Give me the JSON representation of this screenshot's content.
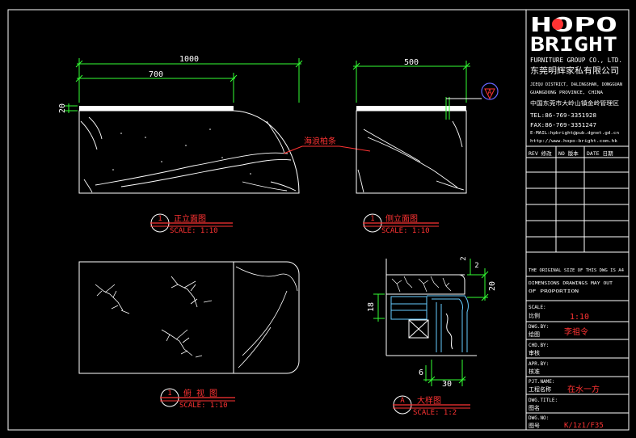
{
  "brand": {
    "logo_line1": "HOPO",
    "logo_line2": "BRIGHT",
    "company_en": "FURNITURE GROUP CO., LTD.",
    "company_cn": "东莞明辉家私有限公司",
    "address_en_1": "JIEQU DISTRICT, DALINGSHAN, DONGGUAN",
    "address_en_2": "GUANGDONG PROVINCE, CHINA",
    "address_cn": "中国东莞市大岭山镇金岭管理区",
    "tel": "TEL:86-769-3351928",
    "fax": "FAX:86-769-3351247",
    "email": "E-MAIL:hpbright@pub.dgnet.gd.cn",
    "web": "http://www.hopo-bright.com.hk"
  },
  "revision_headers": [
    "REV 修改",
    "NO 版本",
    "DATE 日期"
  ],
  "note_lines": [
    "THE ORIGINAL SIZE OF THIS DWG IS A4",
    "DIMENSIONS DRAWINGS MAY OUT",
    "OF PROPORTION"
  ],
  "title_block": {
    "scale_label_en": "SCALE:",
    "scale_label_cn": "比例",
    "scale_value": "1:10",
    "drawn_label_en": "DWG.BY:",
    "drawn_label_cn": "绘图",
    "drawn_value": "李祖令",
    "checked_label_en": "CHD.BY:",
    "checked_label_cn": "审核",
    "approved_label_en": "APR.BY:",
    "approved_label_cn": "核准",
    "project_label_en": "PJT.NAME:",
    "project_label_cn": "工程名称",
    "project_value": "在水一方",
    "title_label_en": "DWG.TITLE:",
    "title_label_cn": "图名",
    "number_label_en": "DWG.NO:",
    "number_label_cn": "图号",
    "number_value": "K/1z1/F35"
  },
  "dimensions": {
    "front_width": "1000",
    "front_sub": "700",
    "front_top": "20",
    "side_width": "500",
    "detail_top_small": "2",
    "detail_top_tick": "2",
    "detail_right": "20",
    "detail_left": "18",
    "detail_bottom_small": "6",
    "detail_bottom": "30"
  },
  "annotation_material": "海浪柏条",
  "callout_tag": "A",
  "views": [
    {
      "num": "1",
      "title": "正立面图",
      "scale": "SCALE: 1:10"
    },
    {
      "num": "1",
      "title": "侧立面图",
      "scale": "SCALE: 1:10"
    },
    {
      "num": "1",
      "title": "俯 视 图",
      "scale": "SCALE: 1:10"
    },
    {
      "num": "A",
      "title": "大样图",
      "scale": "SCALE: 1:2"
    }
  ]
}
